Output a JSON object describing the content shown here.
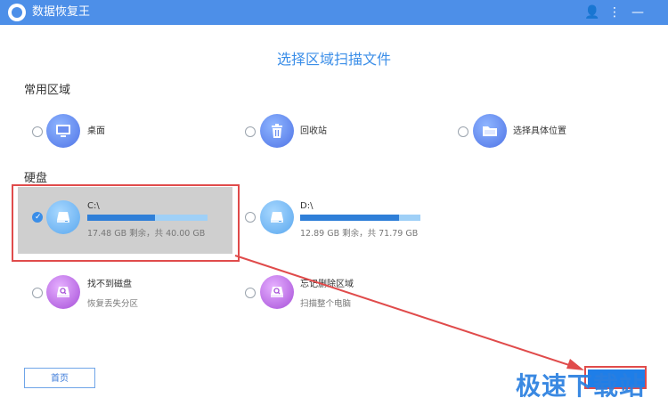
{
  "window": {
    "title": "数据恢复王",
    "controls": {
      "user": "👤",
      "menu": "⋮",
      "minimize": "—"
    }
  },
  "page_title": "选择区域扫描文件",
  "sections": {
    "common": {
      "title": "常用区域",
      "items": [
        {
          "label": "桌面",
          "icon": "monitor-icon"
        },
        {
          "label": "回收站",
          "icon": "recycle-bin-icon"
        },
        {
          "label": "选择具体位置",
          "icon": "folder-icon"
        }
      ]
    },
    "disks": {
      "title": "硬盘",
      "drives": [
        {
          "name": "C:\\",
          "info": "17.48 GB 剩余，共 40.00 GB",
          "used_fraction": 0.563,
          "selected": true
        },
        {
          "name": "D:\\",
          "info": "12.89 GB 剩余，共 71.79 GB",
          "used_fraction": 0.82,
          "selected": false
        }
      ],
      "extra": [
        {
          "label": "找不到磁盘",
          "sub": "恢复丢失分区",
          "icon": "lost-disk-icon"
        },
        {
          "label": "忘记删除区域",
          "sub": "扫描整个电脑",
          "icon": "scan-computer-icon"
        }
      ]
    }
  },
  "buttons": {
    "home": "首页",
    "next": ""
  },
  "watermark": "极速下载站",
  "colors": {
    "accent": "#3b8ee8",
    "titlebar": "#4d8fe8",
    "annotation": "#e04b4b"
  }
}
